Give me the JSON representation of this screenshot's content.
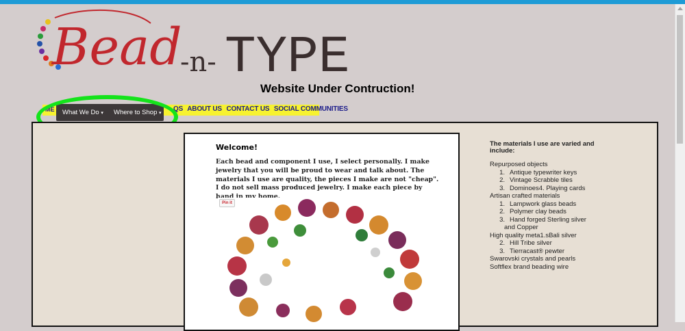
{
  "site": {
    "logo_script": "Bead",
    "logo_dash": "-n-",
    "logo_type": "TYPE",
    "tagline": "Website Under Contruction!"
  },
  "nav": {
    "home_fragment": "ME",
    "dropdown_items": [
      {
        "label": "What We Do",
        "caret": "▾"
      },
      {
        "label": "Where to Shop",
        "caret": "▾"
      }
    ],
    "links": [
      "FAQS",
      "ABOUT US",
      "CONTACT US",
      "SOCIAL COMMUNITIES"
    ],
    "links_visible": [
      "QS",
      "ABOUT US",
      "CONTACT US",
      "SOCIAL COMMUNITIES"
    ]
  },
  "welcome": {
    "title": "Welcome!",
    "body": "Each bead and component I use, I select personally. I make jewelry that you will be proud to wear and talk about. The materials I use are quality, the pieces I make are not \"cheap\". I do not sell mass produced jewelry. I make each piece by hand in my home.",
    "pin_label": "Pin it"
  },
  "materials": {
    "heading": "The materials I use are varied and include:",
    "rows": [
      {
        "type": "cat",
        "text": "Repurposed objects"
      },
      {
        "type": "sub",
        "num": "1.",
        "text": "Antique typewriter keys"
      },
      {
        "type": "sub",
        "num": "2.",
        "text": "Vintage Scrabble tiles"
      },
      {
        "type": "sub",
        "num": "3.",
        "text": "Dominoes4.  Playing cards"
      },
      {
        "type": "cat",
        "text": "Artisan crafted materials"
      },
      {
        "type": "sub",
        "num": "1.",
        "text": "Lampwork glass beads"
      },
      {
        "type": "sub",
        "num": "2.",
        "text": "Polymer clay beads"
      },
      {
        "type": "sub",
        "num": "3.",
        "text": "Hand forged Sterling silver"
      },
      {
        "type": "cont",
        "text": "and Copper"
      },
      {
        "type": "cat",
        "text": "High quality meta1.sBali silver"
      },
      {
        "type": "sub",
        "num": "2.",
        "text": "Hill Tribe silver"
      },
      {
        "type": "sub",
        "num": "3.",
        "text": "Tierracast® pewter"
      },
      {
        "type": "cat",
        "text": "Swarovski crystals and pearls"
      },
      {
        "type": "cat",
        "text": "Softflex brand beading wire"
      }
    ]
  },
  "colors": {
    "page_bg": "#d4cdcd",
    "brand_red": "#c1272d",
    "logo_dark": "#3a2e2e",
    "nav_yellow": "#f7f230",
    "nav_dark": "#3d3839",
    "highlight_green": "#14e31b"
  }
}
